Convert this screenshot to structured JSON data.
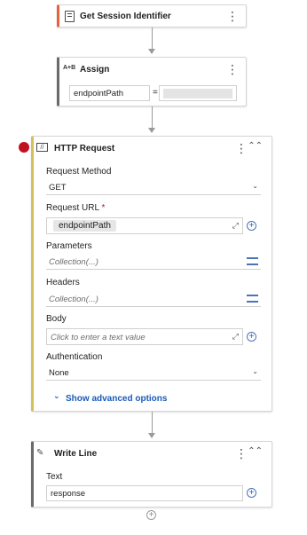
{
  "activities": {
    "get_session": {
      "title": "Get Session Identifier"
    },
    "assign": {
      "title": "Assign",
      "icon_text": "A+B",
      "left_value": "endpointPath",
      "operator": "="
    },
    "http": {
      "title": "HTTP Request",
      "request_method_label": "Request Method",
      "request_method_value": "GET",
      "request_url_label": "Request URL",
      "required_mark": "*",
      "request_url_chip": "endpointPath",
      "parameters_label": "Parameters",
      "parameters_placeholder": "Collection(...)",
      "headers_label": "Headers",
      "headers_placeholder": "Collection(...)",
      "body_label": "Body",
      "body_placeholder": "Click to enter a text value",
      "authentication_label": "Authentication",
      "authentication_value": "None",
      "advanced_options": "Show advanced options"
    },
    "write_line": {
      "title": "Write Line",
      "text_label": "Text",
      "text_value": "response"
    }
  },
  "colors": {
    "accent_orange": "#e8613c",
    "accent_gray": "#6b6b6b",
    "accent_yellow": "#d4c15a",
    "breakpoint": "#c1121f",
    "link": "#1a5bb8"
  }
}
